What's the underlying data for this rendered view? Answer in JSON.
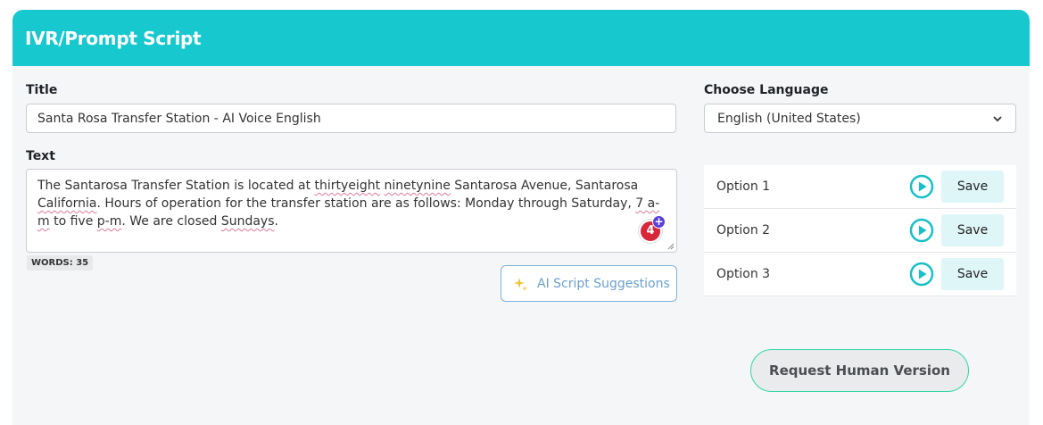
{
  "header": {
    "title": "IVR/Prompt Script"
  },
  "form": {
    "title_label": "Title",
    "title_value": "Santa Rosa Transfer Station - AI Voice English",
    "language_label": "Choose Language",
    "language_value": "English (United States)",
    "text_label": "Text",
    "text_parts": [
      "The Santarosa Transfer Station is located at ",
      "thirtyeight",
      " ",
      "ninetynine",
      " Santarosa Avenue, Santarosa ",
      "California",
      ". Hours of operation for the transfer station are as follows: Monday through Saturday, ",
      "7 a-m",
      " to five ",
      "p-m",
      ". We are closed ",
      "Sundays",
      "."
    ],
    "grammar_count": "4",
    "grammar_plus": "+",
    "word_count": "WORDS: 35",
    "ai_button_label": "AI Script Suggestions"
  },
  "options": [
    {
      "label": "Option 1",
      "save_label": "Save"
    },
    {
      "label": "Option 2",
      "save_label": "Save"
    },
    {
      "label": "Option 3",
      "save_label": "Save"
    }
  ],
  "request_human_label": "Request Human Version",
  "colors": {
    "header_bg": "#17c8cf",
    "play_icon": "#17c0c7",
    "save_bg": "#def6f8",
    "spellcheck_underline": "#e07a9b",
    "ai_button_text": "#6a9fd1",
    "human_button_border": "#2fd6a6",
    "grammar_badge": "#d8263a"
  }
}
